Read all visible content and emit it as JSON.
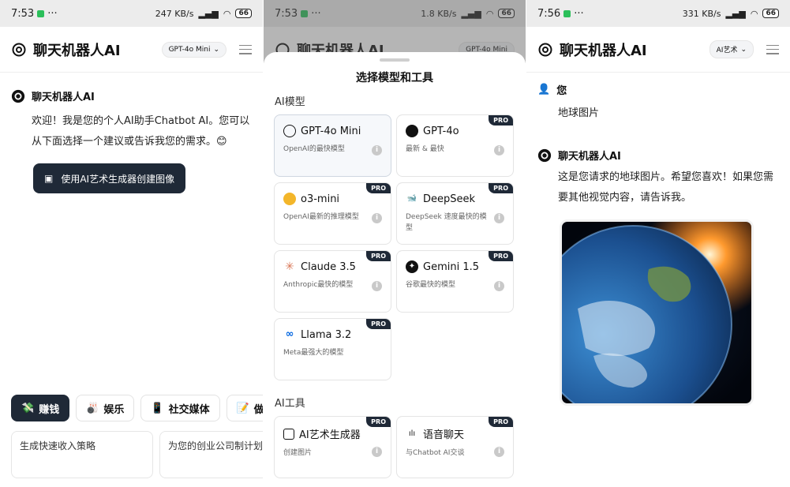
{
  "panel1": {
    "status": {
      "time": "7:53",
      "dots": "···",
      "speed": "247 KB/s",
      "battery": "66"
    },
    "app_title": "聊天机器人AI",
    "model_pill": "GPT-4o Mini",
    "assistant_name": "聊天机器人AI",
    "welcome": "欢迎！我是您的个人AI助手Chatbot AI。您可以从下面选择一个建议或告诉我您的需求。😊",
    "art_button": "使用AI艺术生成器创建图像",
    "categories": [
      {
        "icon": "💸",
        "label": "赚钱"
      },
      {
        "icon": "🎳",
        "label": "娱乐"
      },
      {
        "icon": "📱",
        "label": "社交媒体"
      },
      {
        "icon": "📝",
        "label": "做伙"
      }
    ],
    "suggestions": [
      "生成快速收入策略",
      "为您的创业公司制计划"
    ]
  },
  "panel2": {
    "status": {
      "time": "7:53",
      "dots": "···",
      "speed": "1.8 KB/s",
      "battery": "66"
    },
    "app_title": "聊天机器人AI",
    "model_pill": "GPT-4o Mini",
    "sheet_title": "选择模型和工具",
    "models_label": "AI模型",
    "tools_label": "AI工具",
    "models": [
      {
        "name": "GPT-4o Mini",
        "desc": "OpenAI的最快模型",
        "pro": "",
        "icon": "openai-icon",
        "selected": true
      },
      {
        "name": "GPT-4o",
        "desc": "最新 & 最快",
        "pro": "PRO",
        "icon": "openai-icon"
      },
      {
        "name": "o3-mini",
        "desc": "OpenAI最新的推理模型",
        "pro": "PRO",
        "icon": "openai-icon"
      },
      {
        "name": "DeepSeek",
        "desc": "DeepSeek 速度最快的模型",
        "pro": "PRO",
        "icon": "deepseek-icon"
      },
      {
        "name": "Claude 3.5",
        "desc": "Anthropic最快的模型",
        "pro": "PRO",
        "icon": "claude-icon"
      },
      {
        "name": "Gemini 1.5",
        "desc": "谷歌最快的模型",
        "pro": "PRO",
        "icon": "gemini-icon"
      },
      {
        "name": "Llama 3.2",
        "desc": "Meta最强大的模型",
        "pro": "PRO",
        "icon": "meta-icon"
      }
    ],
    "tools": [
      {
        "name": "AI艺术生成器",
        "desc": "创建图片",
        "pro": "PRO",
        "icon": "image-icon"
      },
      {
        "name": "语音聊天",
        "desc": "与Chatbot AI交谈",
        "pro": "PRO",
        "icon": "voice-icon"
      }
    ],
    "info_glyph": "i"
  },
  "panel3": {
    "status": {
      "time": "7:56",
      "dots": "···",
      "speed": "331 KB/s",
      "battery": "66"
    },
    "app_title": "聊天机器人AI",
    "model_pill": "AI艺术",
    "user_name": "您",
    "user_message": "地球图片",
    "assistant_name": "聊天机器人AI",
    "assistant_reply": "这是您请求的地球图片。希望您喜欢！如果您需要其他视觉内容，请告诉我。"
  },
  "colors": {
    "dark": "#1f2937",
    "pro_badge": "#1f2937",
    "accent_green": "#2bbf5a"
  }
}
